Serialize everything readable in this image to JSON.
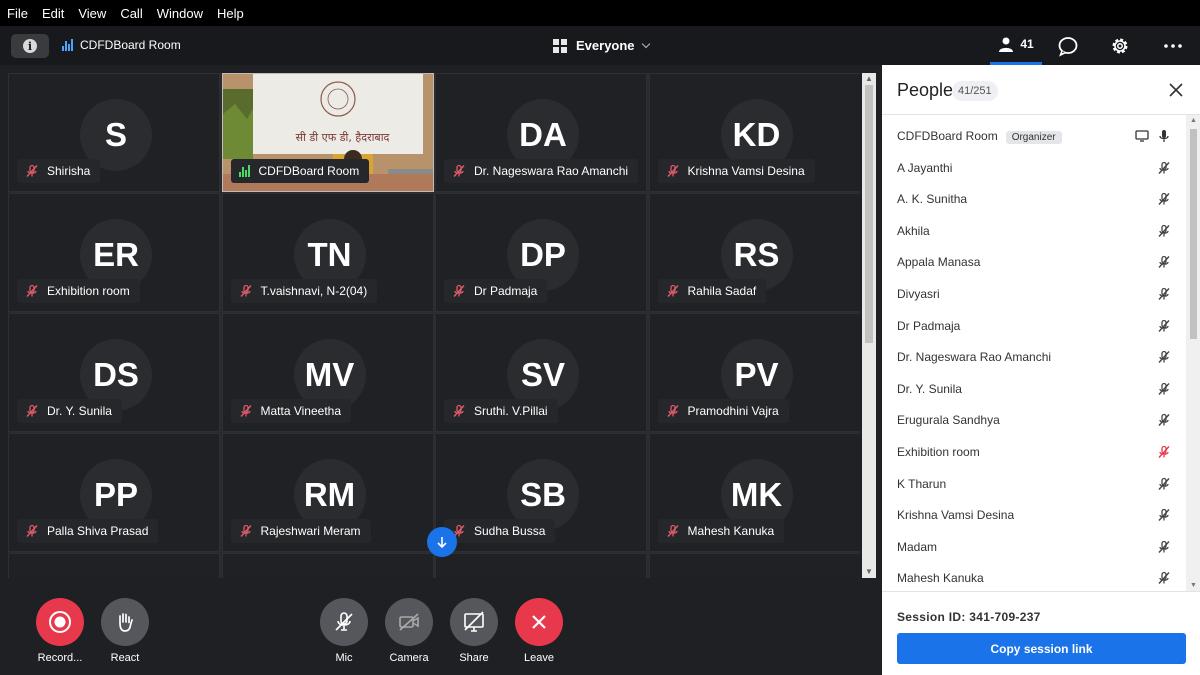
{
  "menu": [
    "File",
    "Edit",
    "View",
    "Call",
    "Window",
    "Help"
  ],
  "toolbar": {
    "room_name": "CDFDBoard Room",
    "view_label": "Everyone",
    "people_count": "41"
  },
  "tiles": [
    {
      "initials": "S",
      "name": "Shirisha"
    },
    {
      "initials": "",
      "name": "CDFDBoard Room",
      "video": true,
      "video_sign": "सी डी एफ डी, हैदराबाद"
    },
    {
      "initials": "DA",
      "name": "Dr. Nageswara Rao Amanchi"
    },
    {
      "initials": "KD",
      "name": "Krishna Vamsi Desina"
    },
    {
      "initials": "ER",
      "name": "Exhibition room"
    },
    {
      "initials": "TN",
      "name": "T.vaishnavi, N-2(04)"
    },
    {
      "initials": "DP",
      "name": "Dr Padmaja"
    },
    {
      "initials": "RS",
      "name": "Rahila Sadaf"
    },
    {
      "initials": "DS",
      "name": "Dr. Y. Sunila"
    },
    {
      "initials": "MV",
      "name": "Matta Vineetha"
    },
    {
      "initials": "SV",
      "name": "Sruthi. V.Pillai"
    },
    {
      "initials": "PV",
      "name": "Pramodhini Vajra"
    },
    {
      "initials": "PP",
      "name": "Palla Shiva Prasad"
    },
    {
      "initials": "RM",
      "name": "Rajeshwari Meram"
    },
    {
      "initials": "SB",
      "name": "Sudha Bussa"
    },
    {
      "initials": "MK",
      "name": "Mahesh Kanuka"
    }
  ],
  "controls": [
    {
      "label": "Record...",
      "icon": "record-icon",
      "color": "#e8394c"
    },
    {
      "label": "React",
      "icon": "hand-icon",
      "color": "#55575c"
    },
    {
      "label": "Mic",
      "icon": "mic-off-icon",
      "color": "#55575c"
    },
    {
      "label": "Camera",
      "icon": "camera-off-icon",
      "color": "#55575c"
    },
    {
      "label": "Share",
      "icon": "share-screen-icon",
      "color": "#55575c"
    },
    {
      "label": "Leave",
      "icon": "close-icon",
      "color": "#e8394c"
    }
  ],
  "people_panel": {
    "title": "People",
    "count": "41/251",
    "organizer_badge": "Organizer",
    "people": [
      {
        "name": "CDFDBoard Room",
        "organizer": true
      },
      {
        "name": "A Jayanthi"
      },
      {
        "name": "A. K. Sunitha"
      },
      {
        "name": "Akhila"
      },
      {
        "name": "Appala Manasa"
      },
      {
        "name": "Divyasri"
      },
      {
        "name": "Dr Padmaja"
      },
      {
        "name": "Dr. Nageswara Rao Amanchi"
      },
      {
        "name": "Dr. Y. Sunila"
      },
      {
        "name": "Erugurala Sandhya"
      },
      {
        "name": "Exhibition room",
        "mic_alert": true
      },
      {
        "name": "K Tharun"
      },
      {
        "name": "Krishna Vamsi Desina"
      },
      {
        "name": "Madam"
      },
      {
        "name": "Mahesh Kanuka"
      }
    ],
    "session_id": "Session ID: 341-709-237",
    "copy_link_label": "Copy session link"
  },
  "colors": {
    "accent": "#1a73e8",
    "danger": "#e8394c",
    "mic_off_tile": "#e05a6a"
  }
}
